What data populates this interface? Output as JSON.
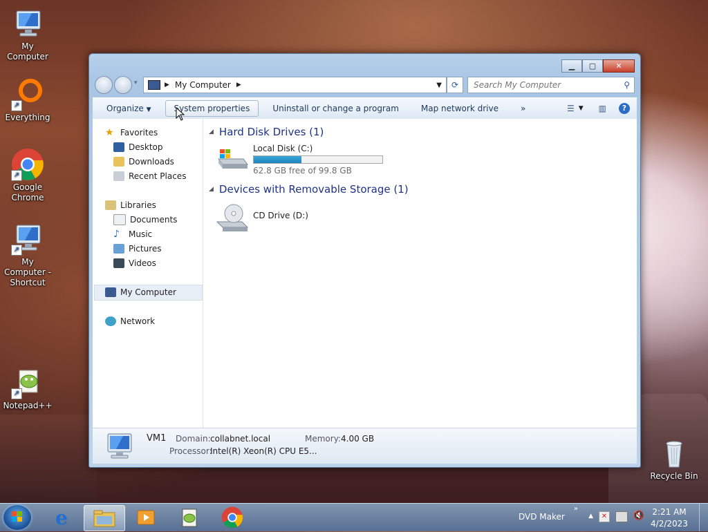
{
  "desktop": {
    "icons": [
      {
        "label": "My Computer"
      },
      {
        "label": "Everything"
      },
      {
        "label": "Google Chrome"
      },
      {
        "label": "My Computer - Shortcut"
      },
      {
        "label": "Notepad++"
      },
      {
        "label": "Recycle Bin"
      }
    ]
  },
  "window": {
    "caption_buttons": {
      "minimize": "minimize-icon",
      "maximize": "maximize-icon",
      "close": "close-icon"
    },
    "address": {
      "location": "My Computer"
    },
    "search": {
      "placeholder": "Search My Computer"
    },
    "toolbar": {
      "organize": "Organize",
      "system_properties": "System properties",
      "uninstall": "Uninstall or change a program",
      "map_drive": "Map network drive",
      "more": "»"
    },
    "sidebar": {
      "favorites": "Favorites",
      "desktop": "Desktop",
      "downloads": "Downloads",
      "recent": "Recent Places",
      "libraries": "Libraries",
      "documents": "Documents",
      "music": "Music",
      "pictures": "Pictures",
      "videos": "Videos",
      "my_computer": "My Computer",
      "network": "Network"
    },
    "groups": {
      "hdd": "Hard Disk Drives (1)",
      "removable": "Devices with Removable Storage (1)"
    },
    "drives": {
      "c_name": "Local Disk (C:)",
      "c_free": "62.8 GB free of 99.8 GB",
      "c_used_fraction": 0.37,
      "d_name": "CD Drive (D:)"
    },
    "details": {
      "name": "VM1",
      "domain_label": "Domain:",
      "domain": "collabnet.local",
      "memory_label": "Memory:",
      "memory": "4.00 GB",
      "processor_label": "Processor:",
      "processor": "Intel(R) Xeon(R) CPU E5..."
    }
  },
  "taskbar": {
    "tray_label": "DVD Maker",
    "time": "2:21 AM",
    "date": "4/2/2023"
  }
}
